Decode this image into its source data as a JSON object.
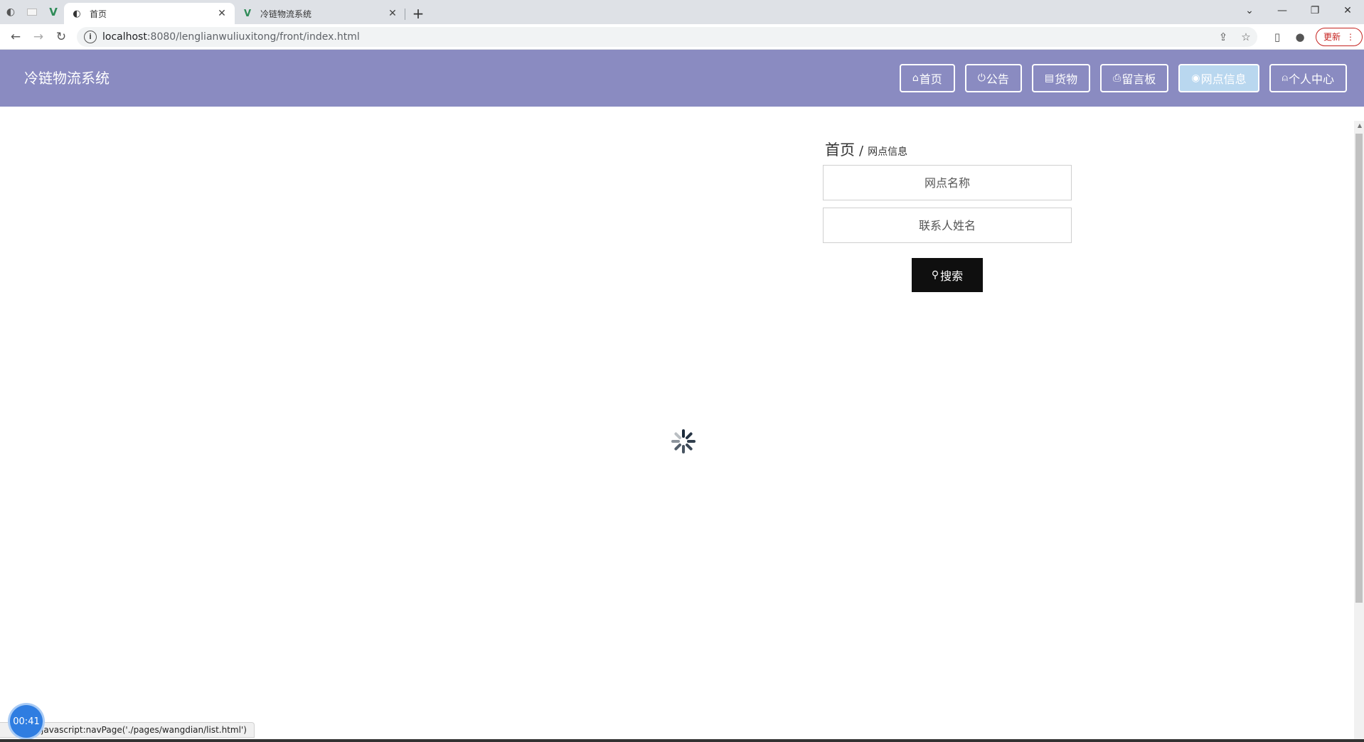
{
  "browser": {
    "tabs": [
      {
        "title": "首页",
        "active": true
      },
      {
        "title": "冷链物流系统",
        "active": false
      }
    ],
    "url_host": "localhost",
    "url_path": ":8080/lenglianwuliuxitong/front/index.html",
    "update_label": "更新"
  },
  "site": {
    "title": "冷链物流系统",
    "nav": [
      {
        "icon": "home-icon",
        "label": "首页"
      },
      {
        "icon": "power-icon",
        "label": "公告"
      },
      {
        "icon": "calendar-icon",
        "label": "货物"
      },
      {
        "icon": "printer-icon",
        "label": "留言板"
      },
      {
        "icon": "globe-icon",
        "label": "网点信息",
        "active": true
      },
      {
        "icon": "user-icon",
        "label": "个人中心"
      }
    ]
  },
  "breadcrumb": {
    "home": "首页",
    "separator": "/",
    "current": "网点信息"
  },
  "search": {
    "name_placeholder": "网点名称",
    "contact_placeholder": "联系人姓名",
    "button_label": "搜索"
  },
  "status_bar": {
    "link_text": "javascript:navPage('./pages/wangdian/list.html')"
  },
  "timer": {
    "value": "00:41"
  },
  "colors": {
    "header_bg": "#8a8bc1",
    "active_nav_bg": "#b9d7ef",
    "search_button_bg": "#0f0f0f"
  }
}
